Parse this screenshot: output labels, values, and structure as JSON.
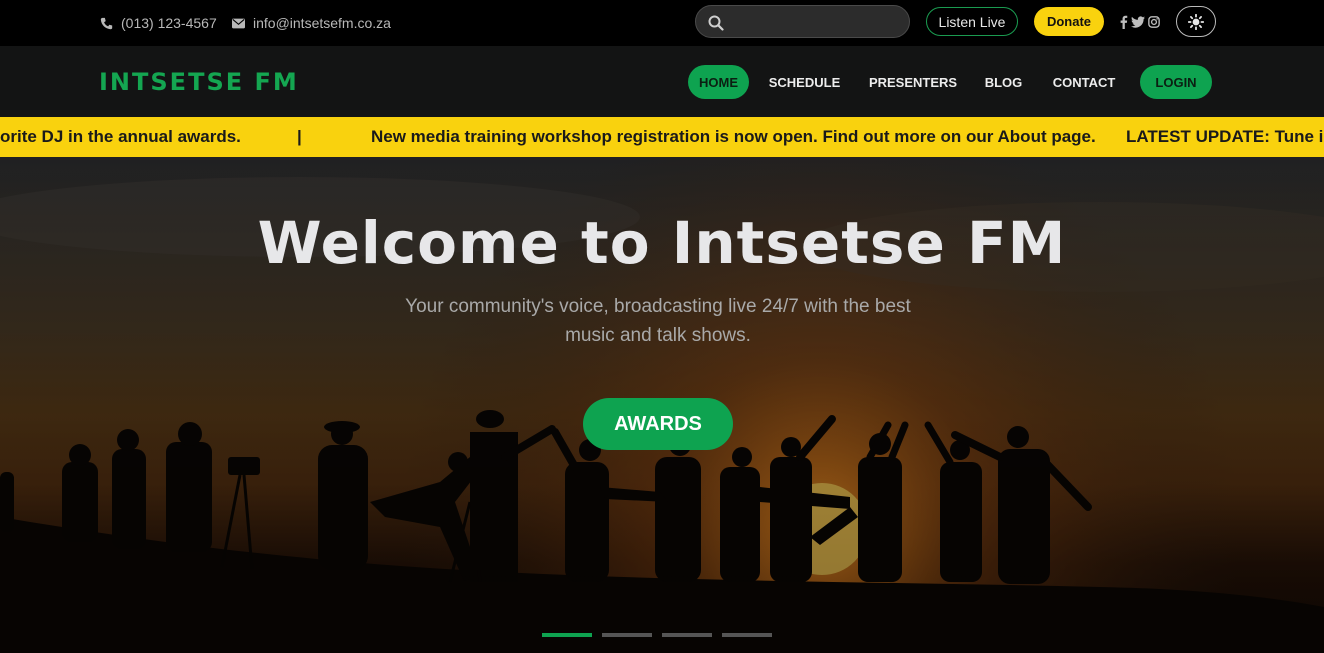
{
  "topbar": {
    "phone": "(013) 123-4567",
    "email": "info@intsetsefm.co.za",
    "search_placeholder": "",
    "listen_live": "Listen Live",
    "donate": "Donate",
    "socials": [
      "facebook-icon",
      "twitter-icon",
      "instagram-icon"
    ],
    "theme_toggle_icon": "sun-icon"
  },
  "nav": {
    "logo": "INTSETSE FM",
    "items": [
      "HOME",
      "SCHEDULE",
      "PRESENTERS",
      "BLOG",
      "CONTACT"
    ],
    "login": "LOGIN",
    "active": "HOME"
  },
  "ticker": {
    "items": [
      "orite DJ in the annual awards.",
      "|",
      "New media training workshop registration is now open. Find out more on our About page.",
      "LATEST UPDATE: Tune in t"
    ]
  },
  "hero": {
    "title": "Welcome to Intsetse FM",
    "subtitle": "Your community's voice, broadcasting live 24/7 with the best music and talk shows.",
    "button": "AWARDS",
    "slides": 4,
    "active_slide": 1
  },
  "colors": {
    "accent_green": "#0ea350",
    "accent_yellow": "#f9d20e",
    "background": "#000000"
  }
}
